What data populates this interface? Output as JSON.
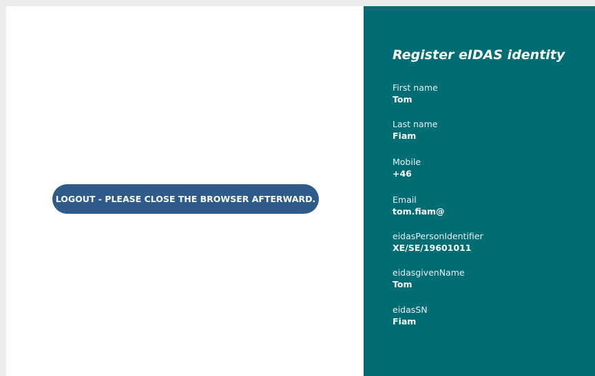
{
  "logout": {
    "label": "LOGOUT - PLEASE CLOSE THE BROWSER AFTERWARD."
  },
  "panel": {
    "title": "Register eIDAS identity",
    "fields": [
      {
        "label": "First name",
        "value": "Tom"
      },
      {
        "label": "Last name",
        "value": "Fiam"
      },
      {
        "label": "Mobile",
        "value": "+46"
      },
      {
        "label": "Email",
        "value": "tom.fiam@"
      },
      {
        "label": "eidasPersonIdentifier",
        "value": "XE/SE/19601011"
      },
      {
        "label": "eidasgivenName",
        "value": "Tom"
      },
      {
        "label": "eidasSN",
        "value": "Fiam"
      }
    ]
  },
  "colors": {
    "panel_bg": "#006d74",
    "button_bg": "#2f5b8b",
    "frame": "#ececec"
  }
}
